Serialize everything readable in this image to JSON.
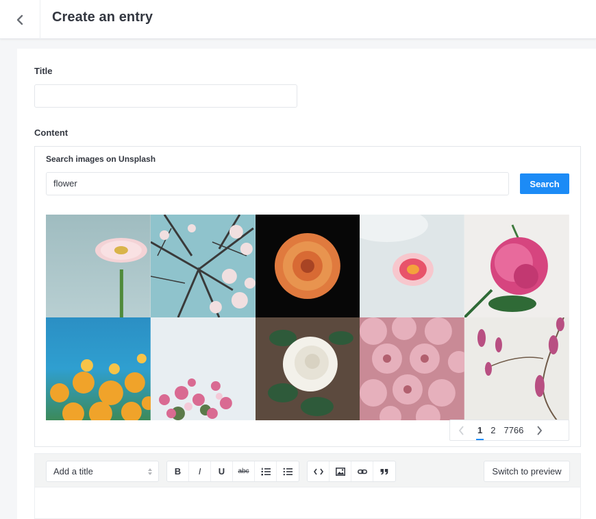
{
  "header": {
    "title": "Create an entry"
  },
  "form": {
    "title_label": "Title",
    "title_value": "",
    "content_label": "Content"
  },
  "unsplash": {
    "label": "Search images on Unsplash",
    "query": "flower",
    "search_label": "Search",
    "images": [
      "gerbera-daisy-photo",
      "cherry-blossom-branches-photo",
      "orange-dahlia-photo",
      "pink-rose-petal-photo",
      "pink-peony-photo",
      "poppy-field-photo",
      "pink-blossoms-photo",
      "white-rose-photo",
      "pink-carnations-photo",
      "magnolia-branch-photo"
    ]
  },
  "pagination": {
    "pages": [
      "1",
      "2",
      "7766"
    ],
    "current": "1"
  },
  "toolbar": {
    "title_select": "Add a title",
    "bold": "B",
    "italic": "I",
    "underline": "U",
    "strike": "abc",
    "preview_label": "Switch to preview"
  },
  "colors": {
    "accent": "#1c8bf6",
    "text": "#333740",
    "border": "#e3e6ea"
  }
}
